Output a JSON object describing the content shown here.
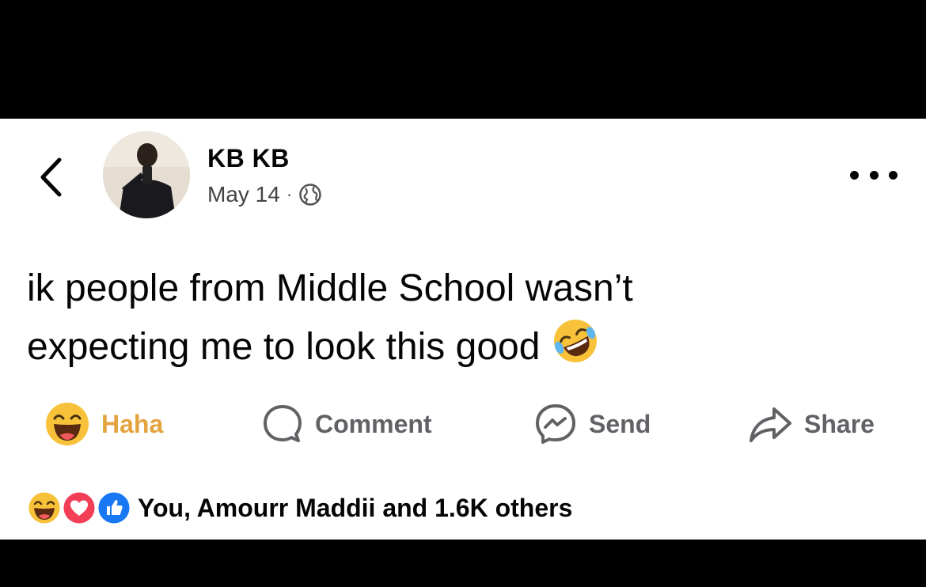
{
  "post": {
    "author_name": "KB KB",
    "date": "May 14",
    "separator": "·",
    "audience_icon": "globe-icon",
    "text_line1": "ik people from Middle School wasn’t",
    "text_line2": "expecting me to look this good",
    "text_emoji": "rolling-on-floor-laughing-emoji"
  },
  "actions": {
    "haha_label": "Haha",
    "comment_label": "Comment",
    "send_label": "Send",
    "share_label": "Share"
  },
  "reactions": {
    "summary_text": "You, Amourr Maddii and 1.6K others",
    "icons": [
      "haha-reaction-icon",
      "love-reaction-icon",
      "like-reaction-icon"
    ]
  },
  "colors": {
    "haha_active": "#e4a33e",
    "action_gray": "#606266",
    "like_blue": "#1877f2",
    "love_red": "#f33e58",
    "text_primary": "#050505"
  }
}
